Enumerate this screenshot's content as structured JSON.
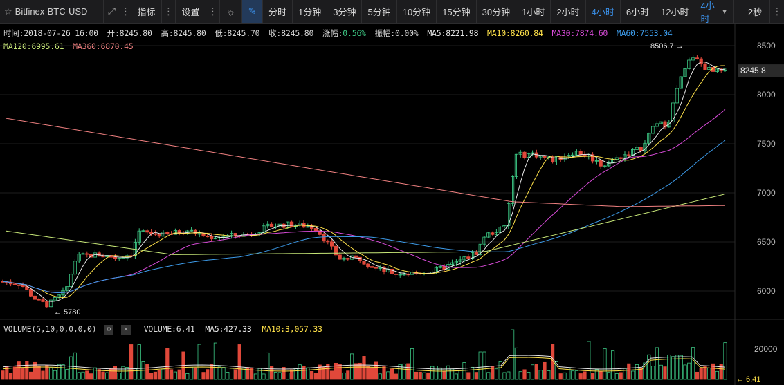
{
  "toolbar": {
    "symbol": "Bitfinex-BTC-USD",
    "indicators_label": "指标",
    "settings_label": "设置",
    "timeframes": [
      "分时",
      "1分钟",
      "3分钟",
      "5分钟",
      "10分钟",
      "15分钟",
      "30分钟",
      "1小时",
      "2小时",
      "4小时",
      "6小时",
      "12小时"
    ],
    "active_timeframe": "4小时",
    "timeframe_dropdown_label": "4小时",
    "refresh_label": "2秒"
  },
  "info": {
    "time": "时间:2018-07-26 16:00",
    "open": "开:8245.80",
    "high": "高:8245.80",
    "low": "低:8245.70",
    "close": "收:8245.80",
    "change_label": "涨幅:",
    "change_value": "0.56%",
    "amplitude": "振幅:0.00%",
    "ma5": "MA5:8221.98",
    "ma10": "MA10:8260.84",
    "ma30": "MA30:7874.60",
    "ma60": "MA60:7553.04",
    "ma120": "MA120:6995.61",
    "ma360": "MA360:6870.45"
  },
  "colors": {
    "up": "#3dc985",
    "down": "#e0483a",
    "ma5": "#e8e8e8",
    "ma10": "#ffe24a",
    "ma30": "#d84bd8",
    "ma60": "#3d9be9",
    "ma120": "#c8e878",
    "ma360": "#f08080",
    "change": "#3dc985"
  },
  "price_axis": {
    "ticks": [
      "8500",
      "8000",
      "7500",
      "7000",
      "6500",
      "6000"
    ],
    "current_price": "8245.8"
  },
  "annotations": {
    "high_label": "8506.7",
    "low_label": "5780"
  },
  "volume": {
    "title": "VOLUME(5,10,0,0,0,0)",
    "value": "VOLUME:6.41",
    "ma5": "MA5:427.33",
    "ma10": "MA10:3,057.33",
    "axis_tick": "20000",
    "last_label": "6.41"
  }
}
